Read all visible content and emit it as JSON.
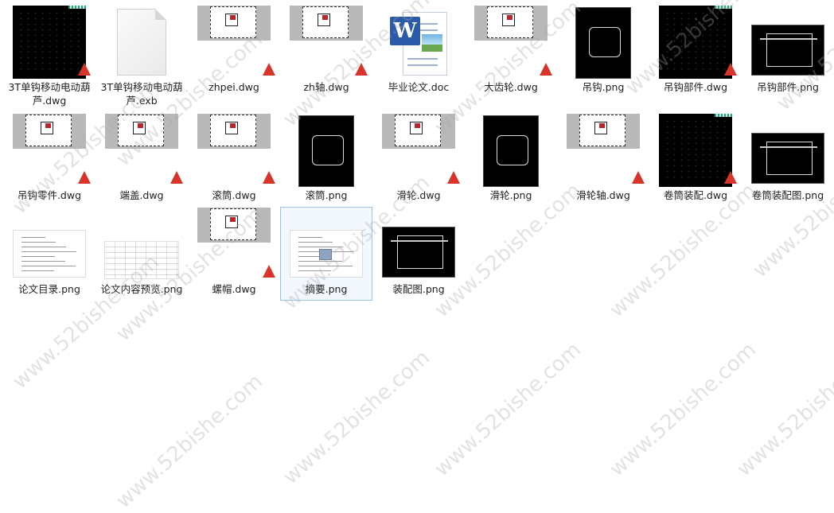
{
  "files": [
    {
      "name": "3T单钩移动电动葫芦.dwg",
      "thumb": "black-dwg",
      "badge": true,
      "selected": false
    },
    {
      "name": "3T单钩移动电动葫芦.exb",
      "thumb": "blank-file",
      "badge": false,
      "selected": false
    },
    {
      "name": "zhpei.dwg",
      "thumb": "grey-sheet-dwg",
      "badge": true,
      "selected": false
    },
    {
      "name": "zh轴.dwg",
      "thumb": "grey-sheet-dwg",
      "badge": true,
      "selected": false
    },
    {
      "name": "毕业论文.doc",
      "thumb": "word-doc",
      "badge": false,
      "selected": false
    },
    {
      "name": "大齿轮.dwg",
      "thumb": "grey-sheet-dwg",
      "badge": true,
      "selected": false
    },
    {
      "name": "吊钩.png",
      "thumb": "black-png",
      "badge": false,
      "selected": false
    },
    {
      "name": "吊钩部件.dwg",
      "thumb": "black-dwg",
      "badge": true,
      "selected": false
    },
    {
      "name": "吊钩部件.png",
      "thumb": "wide-png",
      "badge": false,
      "selected": false
    },
    {
      "name": "吊钩零件.dwg",
      "thumb": "grey-sheet-dwg",
      "badge": true,
      "selected": false
    },
    {
      "name": "端盖.dwg",
      "thumb": "grey-sheet-dwg",
      "badge": true,
      "selected": false
    },
    {
      "name": "滚筒.dwg",
      "thumb": "grey-sheet-dwg",
      "badge": true,
      "selected": false
    },
    {
      "name": "滚筒.png",
      "thumb": "black-png",
      "badge": false,
      "selected": false
    },
    {
      "name": "滑轮.dwg",
      "thumb": "grey-sheet-dwg",
      "badge": true,
      "selected": false
    },
    {
      "name": "滑轮.png",
      "thumb": "black-png",
      "badge": false,
      "selected": false
    },
    {
      "name": "滑轮轴.dwg",
      "thumb": "grey-sheet-dwg",
      "badge": true,
      "selected": false
    },
    {
      "name": "卷筒装配.dwg",
      "thumb": "black-dwg",
      "badge": true,
      "selected": false
    },
    {
      "name": "卷筒装配图.png",
      "thumb": "wide-png",
      "badge": false,
      "selected": false
    },
    {
      "name": "论文目录.png",
      "thumb": "doc-png",
      "badge": false,
      "selected": false
    },
    {
      "name": "论文内容预览.png",
      "thumb": "doc-grid-png",
      "badge": false,
      "selected": false
    },
    {
      "name": "螺帽.dwg",
      "thumb": "grey-sheet-dwg",
      "badge": true,
      "selected": false
    },
    {
      "name": "摘要.png",
      "thumb": "doc-png",
      "badge": false,
      "selected": true
    },
    {
      "name": "装配图.png",
      "thumb": "wide-png",
      "badge": false,
      "selected": false
    }
  ],
  "watermark": "www.52bishe.com",
  "colors": {
    "selection_border": "#99c6ee",
    "selection_fill": "#f2f8fe",
    "dwg_badge": "#d8342c",
    "word_blue": "#2a5aa8"
  }
}
